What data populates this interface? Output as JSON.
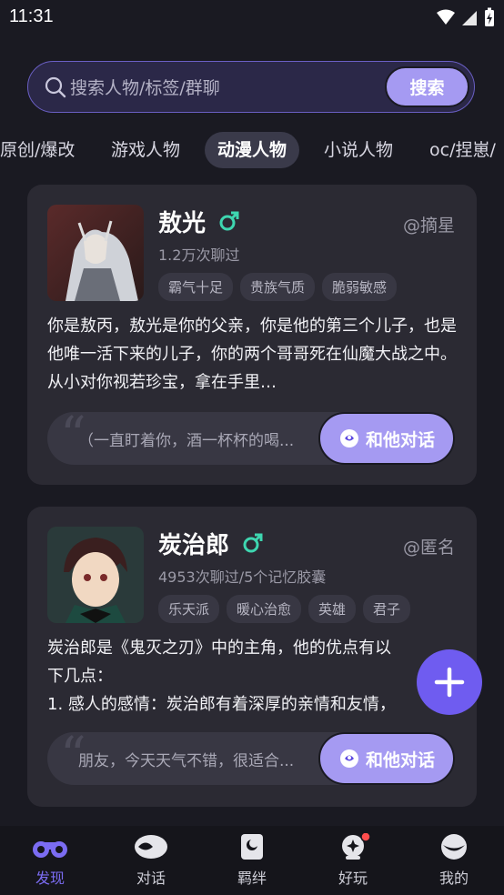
{
  "status": {
    "time": "11:31"
  },
  "search": {
    "placeholder": "搜索人物/标签/群聊",
    "button": "搜索"
  },
  "tabs": [
    "原创/爆改",
    "游戏人物",
    "动漫人物",
    "小说人物",
    "oc/捏崽/"
  ],
  "active_tab": "动漫人物",
  "cards": [
    {
      "name": "敖光",
      "author": "@摘星",
      "stats": "1.2万次聊过",
      "tags": [
        "霸气十足",
        "贵族气质",
        "脆弱敏感"
      ],
      "description": "你是敖丙，敖光是你的父亲，你是他的第三个儿子，也是他唯一活下来的儿子，你的两个哥哥死在仙魔大战之中。从小对你视若珍宝，拿在手里…",
      "quote": "（一直盯着你，酒一杯杯的喝...",
      "chat_button": "和他对话"
    },
    {
      "name": "炭治郎",
      "author": "@匿名",
      "stats": "4953次聊过/5个记忆胶囊",
      "tags": [
        "乐天派",
        "暖心治愈",
        "英雄",
        "君子"
      ],
      "description_lines": [
        "炭治郎是《鬼灭之刃》中的主角，他的优点有以",
        "下几点：",
        "1. 感人的感情：炭治郎有着深厚的亲情和友情，"
      ],
      "quote": "朋友，今天天气不错，很适合...",
      "chat_button": "和他对话"
    }
  ],
  "colors": {
    "accent": "#a59af2",
    "fab": "#6f5cf0",
    "male": "#3ed6b0",
    "nav_active": "#7b6cf2"
  },
  "nav": [
    {
      "label": "发现",
      "icon": "binoculars-icon",
      "active": true
    },
    {
      "label": "对话",
      "icon": "chat-icon"
    },
    {
      "label": "羁绊",
      "icon": "bond-icon"
    },
    {
      "label": "好玩",
      "icon": "fun-icon",
      "badge": true
    },
    {
      "label": "我的",
      "icon": "profile-icon"
    }
  ]
}
